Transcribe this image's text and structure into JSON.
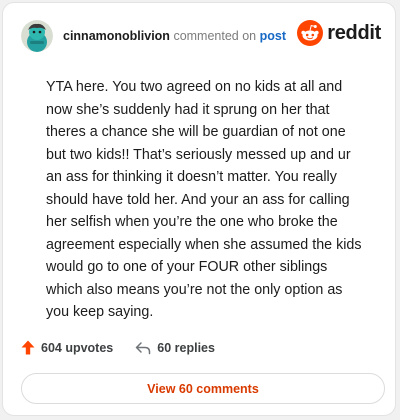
{
  "comment": {
    "author": "cinnamonoblivion",
    "action": "commented on",
    "link_text": "post",
    "body": "YTA here. You two agreed on no kids at all and now she’s suddenly had it sprung on her that theres a chance she will be guardian of not one but two kids!! That’s seriously messed up and ur an ass for thinking it doesn’t matter. You really should have told her. And your an ass for calling her selfish when you’re the one who broke the agreement especially when she assumed the kids would go to one of your FOUR other siblings which also means you’re not the only option as you keep saying."
  },
  "brand": {
    "name": "reddit",
    "color": "#ff4500"
  },
  "stats": {
    "upvotes": "604 upvotes",
    "replies": "60 replies"
  },
  "actions": {
    "view_comments": "View 60 comments"
  },
  "colors": {
    "upvote": "#ff4500",
    "link": "#1868c5",
    "button_text": "#d93a00",
    "avatar_bg": "#24a0a0"
  },
  "icons": {
    "avatar": "avatar-image",
    "brand": "reddit-snoo-icon",
    "upvote": "upvote-arrow-icon",
    "reply": "reply-arrow-icon"
  }
}
